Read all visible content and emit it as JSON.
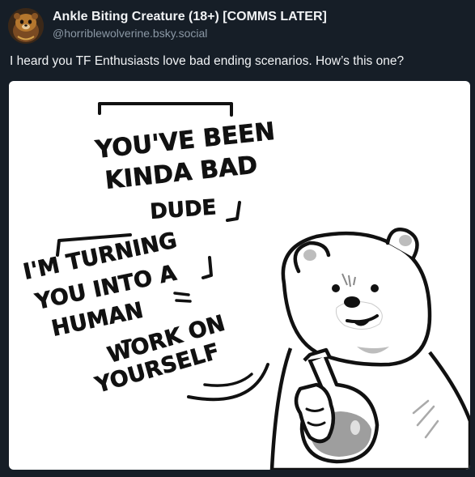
{
  "post": {
    "author": {
      "display_name": "Ankle Biting Creature (18+) [COMMS LATER]",
      "handle": "@horriblewolverine.bsky.social",
      "avatar_icon": "wolverine-avatar-icon"
    },
    "text": "I heard you TF Enthusiasts love bad ending scenarios. How’s this one?",
    "image": {
      "speech_bubble_1": [
        "YOU'VE BEEN",
        "KINDA BAD",
        "DUDE"
      ],
      "speech_bubble_2": [
        "I'M TURNING",
        "YOU INTO A",
        "HUMAN",
        "WORK ON",
        "YOURSELF"
      ],
      "character": "polar-bear-holding-potion"
    }
  },
  "colors": {
    "background": "#161e27",
    "text_primary": "#f1f3f5",
    "text_secondary": "#8b98a5",
    "image_background": "#ffffff"
  }
}
